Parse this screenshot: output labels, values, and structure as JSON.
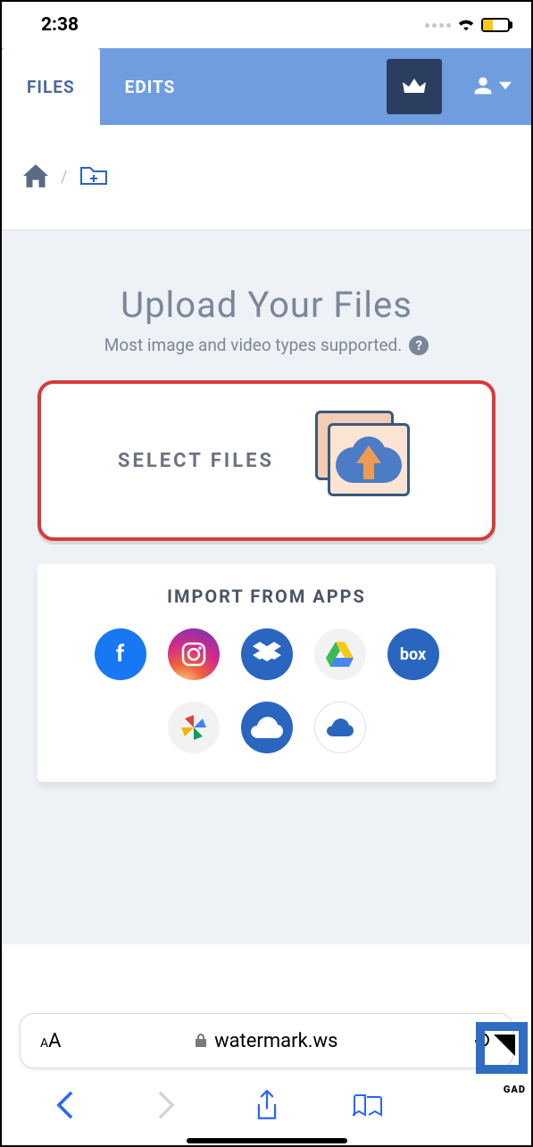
{
  "status": {
    "time": "2:38"
  },
  "header": {
    "tabs": {
      "files": "FILES",
      "edits": "EDITS"
    }
  },
  "upload": {
    "title": "Upload Your Files",
    "subtitle": "Most image and video types supported.",
    "select_label": "SELECT FILES"
  },
  "import": {
    "title": "IMPORT FROM APPS",
    "apps": {
      "facebook": "f",
      "box": "box"
    }
  },
  "browser": {
    "url": "watermark.ws"
  },
  "corner": {
    "text": "GAD"
  }
}
